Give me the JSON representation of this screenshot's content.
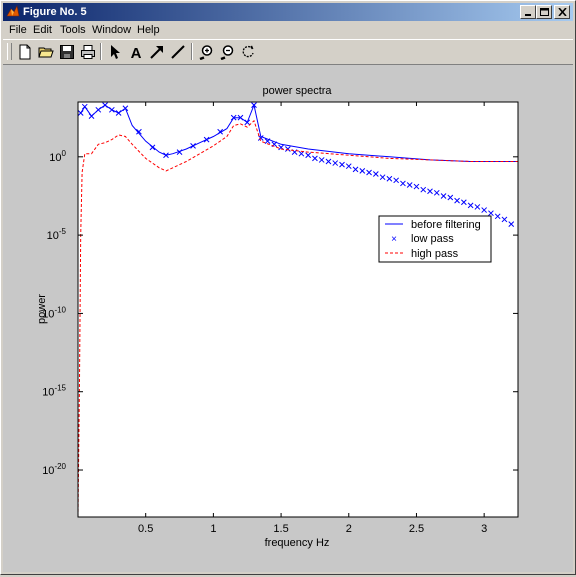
{
  "window": {
    "title": "Figure No. 5",
    "minimize_icon": "minimize-icon",
    "maximize_icon": "maximize-icon",
    "close_icon": "close-icon"
  },
  "menubar": {
    "items": [
      {
        "label": "File"
      },
      {
        "label": "Edit"
      },
      {
        "label": "Tools"
      },
      {
        "label": "Window"
      },
      {
        "label": "Help"
      }
    ]
  },
  "toolbar": {
    "buttons": [
      "new-file-icon",
      "open-folder-icon",
      "save-icon",
      "print-icon",
      "arrow-pointer-icon",
      "insert-text-icon",
      "insert-arrow-icon",
      "insert-line-icon",
      "zoom-in-icon",
      "zoom-out-icon",
      "rotate-icon"
    ],
    "text_tool_glyph": "A"
  },
  "chart_data": {
    "type": "line",
    "title": "power spectra",
    "xlabel": "frequency Hz",
    "ylabel": "power",
    "xlim": [
      0,
      3.25
    ],
    "ylim_log10": [
      -23,
      3.5
    ],
    "yscale": "log",
    "x_ticks": [
      "0.5",
      "1",
      "1.5",
      "2",
      "2.5",
      "3"
    ],
    "x_tick_values": [
      0.5,
      1,
      1.5,
      2,
      2.5,
      3
    ],
    "y_ticks": [
      {
        "base": "10",
        "exp": "0",
        "log10": 0
      },
      {
        "base": "10",
        "exp": "-5",
        "log10": -5
      },
      {
        "base": "10",
        "exp": "-10",
        "log10": -10
      },
      {
        "base": "10",
        "exp": "-15",
        "log10": -15
      },
      {
        "base": "10",
        "exp": "-20",
        "log10": -20
      }
    ],
    "grid": false,
    "legend_position": "right",
    "series": [
      {
        "name": "before filtering",
        "style": "solid",
        "color": "#0000ff",
        "x": [
          0.02,
          0.05,
          0.1,
          0.15,
          0.2,
          0.25,
          0.3,
          0.35,
          0.4,
          0.5,
          0.6,
          0.65,
          0.7,
          0.8,
          0.9,
          1.0,
          1.1,
          1.15,
          1.2,
          1.25,
          1.3,
          1.35,
          1.5,
          1.7,
          2.0,
          2.3,
          2.6,
          2.9,
          3.1,
          3.25
        ],
        "log10y": [
          2.8,
          3.2,
          2.6,
          3.0,
          3.3,
          3.0,
          2.8,
          3.1,
          2.0,
          1.0,
          0.3,
          0.1,
          0.2,
          0.5,
          0.9,
          1.3,
          1.8,
          2.5,
          2.5,
          2.2,
          3.3,
          1.3,
          0.8,
          0.5,
          0.2,
          0.0,
          -0.2,
          -0.3,
          -0.3,
          -0.3
        ]
      },
      {
        "name": "low pass",
        "style": "x-markers",
        "color": "#0000ff",
        "x": [
          0.02,
          0.05,
          0.1,
          0.15,
          0.2,
          0.25,
          0.3,
          0.35,
          0.45,
          0.55,
          0.65,
          0.75,
          0.85,
          0.95,
          1.05,
          1.15,
          1.2,
          1.25,
          1.3,
          1.35,
          1.4,
          1.45,
          1.5,
          1.55,
          1.6,
          1.65,
          1.7,
          1.75,
          1.8,
          1.85,
          1.9,
          1.95,
          2.0,
          2.05,
          2.1,
          2.15,
          2.2,
          2.25,
          2.3,
          2.35,
          2.4,
          2.45,
          2.5,
          2.55,
          2.6,
          2.65,
          2.7,
          2.75,
          2.8,
          2.85,
          2.9,
          2.95,
          3.0,
          3.05,
          3.1,
          3.15,
          3.2
        ],
        "log10y": [
          2.8,
          3.2,
          2.6,
          3.0,
          3.3,
          3.0,
          2.8,
          3.1,
          1.6,
          0.6,
          0.1,
          0.3,
          0.7,
          1.1,
          1.6,
          2.5,
          2.5,
          2.2,
          3.3,
          1.2,
          1.0,
          0.8,
          0.6,
          0.5,
          0.3,
          0.2,
          0.1,
          -0.1,
          -0.2,
          -0.3,
          -0.4,
          -0.5,
          -0.6,
          -0.8,
          -0.9,
          -1.0,
          -1.1,
          -1.3,
          -1.4,
          -1.5,
          -1.7,
          -1.8,
          -1.9,
          -2.1,
          -2.2,
          -2.3,
          -2.5,
          -2.6,
          -2.8,
          -2.9,
          -3.1,
          -3.2,
          -3.4,
          -3.6,
          -3.8,
          -4.0,
          -4.3
        ]
      },
      {
        "name": "high pass",
        "style": "dashed",
        "color": "#ff0000",
        "x": [
          0.0,
          0.01,
          0.02,
          0.03,
          0.05,
          0.1,
          0.15,
          0.2,
          0.25,
          0.3,
          0.35,
          0.4,
          0.5,
          0.6,
          0.65,
          0.7,
          0.8,
          0.9,
          1.0,
          1.1,
          1.15,
          1.2,
          1.25,
          1.3,
          1.35,
          1.5,
          1.7,
          2.0,
          2.3,
          2.6,
          2.9,
          3.1,
          3.25
        ],
        "log10y": [
          -23.0,
          -15.0,
          -5.0,
          -1.0,
          0.2,
          0.2,
          0.8,
          0.9,
          1.1,
          1.4,
          1.3,
          0.8,
          -0.1,
          -0.7,
          -0.9,
          -0.7,
          -0.3,
          0.2,
          0.7,
          1.3,
          2.0,
          2.1,
          1.9,
          2.3,
          1.0,
          0.5,
          0.3,
          0.1,
          -0.1,
          -0.2,
          -0.3,
          -0.3,
          -0.3
        ]
      }
    ]
  }
}
